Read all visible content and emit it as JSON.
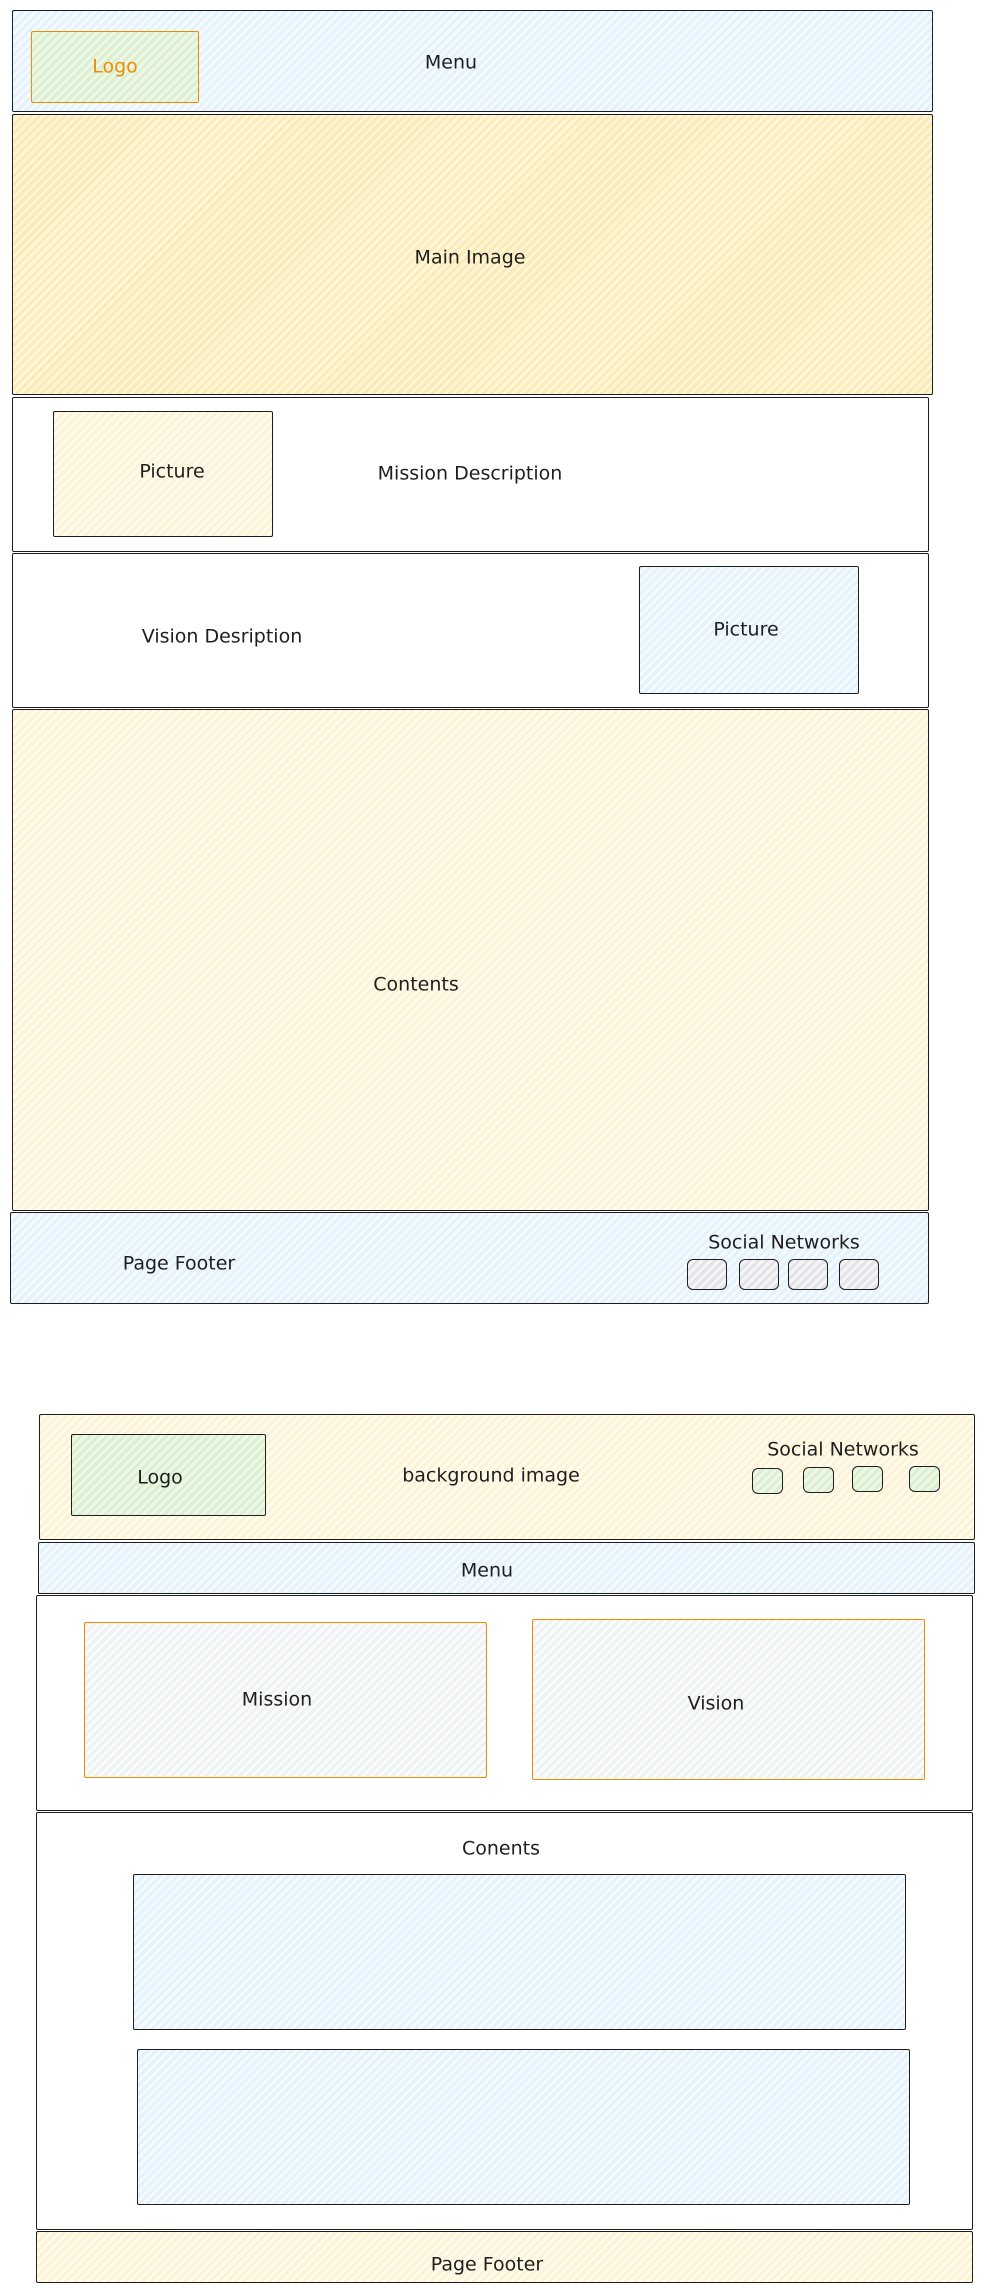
{
  "wireframe1": {
    "logo": "Logo",
    "menu": "Menu",
    "main_image": "Main Image",
    "mission_picture": "Picture",
    "mission_description": "Mission Description",
    "vision_description": "Vision Desription",
    "vision_picture": "Picture",
    "contents": "Contents",
    "footer": "Page Footer",
    "social_networks": "Social Networks"
  },
  "wireframe2": {
    "logo": "Logo",
    "background_image": "background image",
    "social_networks": "Social Networks",
    "menu": "Menu",
    "mission": "Mission",
    "vision": "Vision",
    "contents": "Conents",
    "footer": "Page Footer"
  },
  "colors": {
    "stroke": "#1e1e1e",
    "accent_orange": "#f08c00",
    "blue_fill": "#e3f2fb",
    "yellow_fill": "#fbebb6",
    "cream_fill": "#fdf3d4",
    "green_fill": "#dcefd0"
  }
}
